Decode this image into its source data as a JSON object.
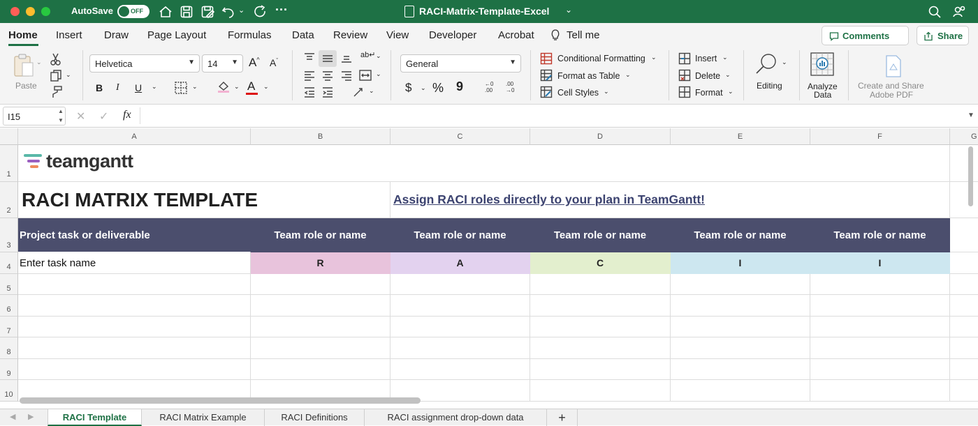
{
  "titlebar": {
    "autosave_label": "AutoSave",
    "autosave_state": "OFF",
    "doc_title": "RACI-Matrix-Template-Excel",
    "bg_color": "#1e7145"
  },
  "tabs": [
    "Home",
    "Insert",
    "Draw",
    "Page Layout",
    "Formulas",
    "Data",
    "Review",
    "View",
    "Developer",
    "Acrobat",
    "Tell me"
  ],
  "active_tab": "Home",
  "comments_label": "Comments",
  "share_label": "Share",
  "ribbon": {
    "paste_label": "Paste",
    "font_name": "Helvetica",
    "font_size": "14",
    "bold": "B",
    "italic": "I",
    "underline": "U",
    "number_format": "General",
    "currency": "$",
    "percent": "%",
    "comma": "9",
    "cond_format": "Conditional Formatting",
    "format_table": "Format as Table",
    "cell_styles": "Cell Styles",
    "insert": "Insert",
    "delete": "Delete",
    "format": "Format",
    "editing": "Editing",
    "analyze_l1": "Analyze",
    "analyze_l2": "Data",
    "adobe_l1": "Create and Share",
    "adobe_l2": "Adobe PDF",
    "font_grow": "A",
    "font_shrink": "A",
    "font_color_letter": "A",
    "wrap_label": "ab"
  },
  "formula_bar": {
    "name_box": "I15",
    "fx": "fx",
    "cancel": "✕",
    "enter": "✓",
    "content": ""
  },
  "columns": [
    "A",
    "B",
    "C",
    "D",
    "E",
    "F",
    "G"
  ],
  "rows": [
    "1",
    "2",
    "3",
    "4",
    "5",
    "6",
    "7",
    "8",
    "9",
    "10"
  ],
  "sheet": {
    "logo_text": "teamgantt",
    "title": "RACI MATRIX TEMPLATE",
    "link_text": "Assign RACI roles directly to your plan in TeamGantt!",
    "header_task": "Project task or deliverable",
    "header_roles": [
      "Team role or name",
      "Team role or name",
      "Team role or name",
      "Team role or name",
      "Team role or name"
    ],
    "row4_task": "Enter task name",
    "row4_values": [
      "R",
      "A",
      "C",
      "I",
      "I"
    ],
    "header_color": "#4b4e6d",
    "role_colors": [
      "#e8c3dc",
      "#e3d2ef",
      "#e3efce",
      "#cde7f0",
      "#cde7f0"
    ]
  },
  "sheet_tabs": [
    "RACI Template",
    "RACI Matrix Example",
    "RACI Definitions",
    "RACI assignment drop-down data"
  ],
  "active_sheet": "RACI Template",
  "add_sheet": "+"
}
